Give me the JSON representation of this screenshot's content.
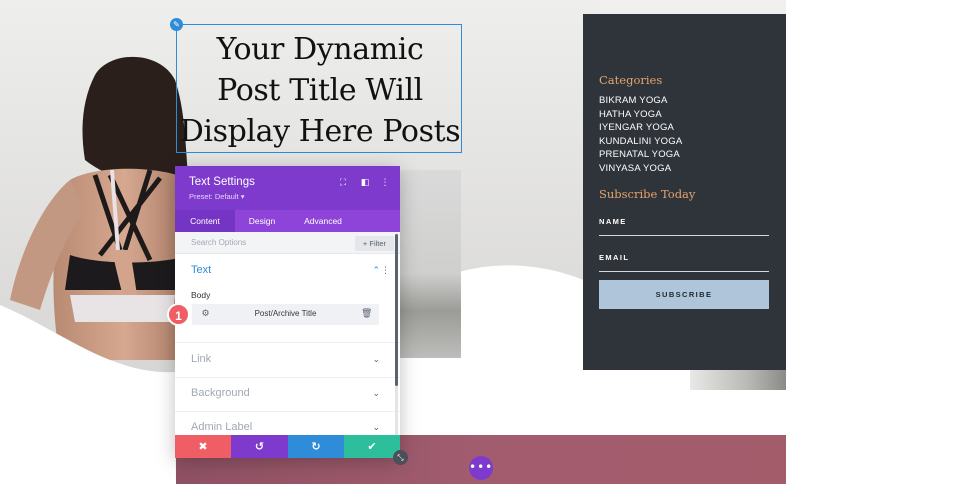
{
  "page": {
    "title_lines": [
      "Your Dynamic",
      "Post Title Will",
      "Display Here Posts"
    ]
  },
  "sidebar": {
    "categories_heading": "Categories",
    "categories": [
      "BIKRAM YOGA",
      "HATHA YOGA",
      "IYENGAR YOGA",
      "KUNDALINI YOGA",
      "PRENATAL YOGA",
      "VINYASA YOGA"
    ],
    "subscribe_heading": "Subscribe Today",
    "name_label": "NAME",
    "email_label": "EMAIL",
    "subscribe_button": "SUBSCRIBE",
    "colors": {
      "background": "#2f333a",
      "heading": "#e3a56f",
      "button": "#aec5da"
    }
  },
  "modal": {
    "title": "Text Settings",
    "preset": "Preset: Default ▾",
    "header_icons": [
      "expand-icon",
      "sidebar-toggle-icon",
      "more-options-icon"
    ],
    "tabs": [
      {
        "label": "Content",
        "active": true
      },
      {
        "label": "Design",
        "active": false
      },
      {
        "label": "Advanced",
        "active": false
      }
    ],
    "search_placeholder": "Search Options",
    "filter_label": "+ Filter",
    "text_section": {
      "title": "Text",
      "body_label": "Body",
      "dynamic_value": "Post/Archive Title"
    },
    "collapsed_sections": [
      "Link",
      "Background",
      "Admin Label"
    ],
    "footer_buttons": [
      {
        "name": "discard",
        "icon": "close-icon",
        "color": "#ef5e64"
      },
      {
        "name": "undo",
        "icon": "undo-icon",
        "color": "#7d3acd"
      },
      {
        "name": "redo",
        "icon": "redo-icon",
        "color": "#2e8cd8"
      },
      {
        "name": "save",
        "icon": "check-icon",
        "color": "#2dbf9c"
      }
    ],
    "colors": {
      "header": "#7d3acd",
      "tabs": "#8e44d8",
      "accent": "#2e8cd8"
    }
  },
  "annotation": {
    "step_number": "1"
  }
}
